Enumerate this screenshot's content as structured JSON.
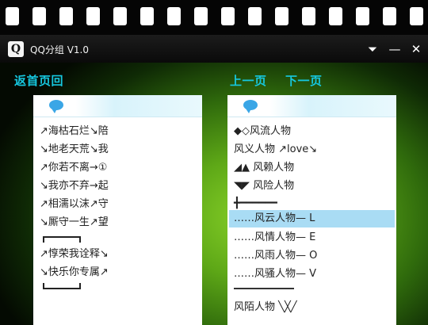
{
  "window": {
    "app_icon_letter": "Q",
    "title": "QQ分组 V1.0",
    "menu_glyph": "⏷",
    "minimize_glyph": "—",
    "close_glyph": "✕"
  },
  "nav": {
    "home": "返首页回",
    "prev": "上一页",
    "next": "下一页"
  },
  "left_panel": {
    "items": [
      "↗海枯石烂↘陪",
      "↘地老天荒↘我",
      "↗你若不离→①",
      "↘我亦不弃→起",
      "↗相濡以沫↗守",
      "↘厮守一生↗望",
      "↗惇荣我诠释↘",
      "↘快乐你专属↗"
    ]
  },
  "right_panel": {
    "items": [
      "◆◇风流人物",
      "风义人物 ↗love↘",
      "◢▲ 风赖人物",
      "◥◤ 风险人物",
      "╋━━━━━━",
      "……风云人物— L",
      "……风情人物— E",
      "……风雨人物— O",
      "……风骚人物— V",
      "风陌人物 ╲╳╱"
    ],
    "selected_index": 5
  },
  "colors": {
    "accent": "#16c7df",
    "selection": "#a9dcf4",
    "bubble": "#3aa6e6"
  }
}
